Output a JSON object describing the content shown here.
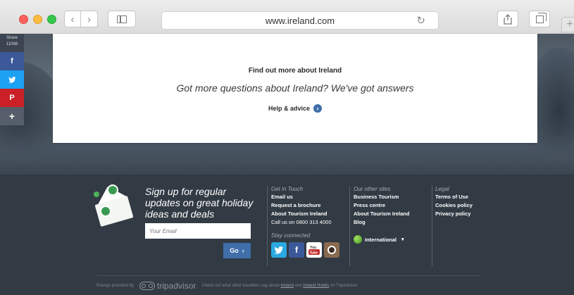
{
  "browser": {
    "url": "www.ireland.com",
    "icons": {
      "back": "chevron-left-icon",
      "forward": "chevron-right-icon",
      "sidebar": "sidebar-icon",
      "reload": "reload-icon",
      "share": "share-icon",
      "tabs": "tabs-icon",
      "new_tab": "plus-icon"
    }
  },
  "share_bar": {
    "label": "Share",
    "count": "11068",
    "items": [
      {
        "icon": "facebook-icon",
        "glyph": "f"
      },
      {
        "icon": "twitter-icon",
        "glyph": "t"
      },
      {
        "icon": "pinterest-icon",
        "glyph": "p"
      },
      {
        "icon": "plus-icon",
        "glyph": "+"
      }
    ]
  },
  "card": {
    "title": "Find out more about Ireland",
    "subtitle": "Got more questions about Ireland? We've got answers",
    "link": "Help & advice"
  },
  "footer": {
    "signup": {
      "heading": "Sign up for regular updates on great holiday ideas and deals",
      "email_placeholder": "Your Email",
      "go_label": "Go",
      "go_arrow": "›"
    },
    "contact": {
      "heading": "Get in Touch",
      "email": "Email us",
      "brochure": "Request a brochure",
      "about": "About Tourism Ireland",
      "phone": "Call us on 0800 313 4000",
      "stay_heading": "Stay connected",
      "socials": [
        "twitter-icon",
        "facebook-icon",
        "youtube-icon",
        "instagram-icon"
      ]
    },
    "other_sites": {
      "heading": "Our other sites",
      "links": [
        "Business Tourism",
        "Press centre",
        "About Tourism Ireland",
        "Blog"
      ],
      "region": "International"
    },
    "legal": {
      "heading": "Legal",
      "links": [
        "Terms of Use",
        "Cookies policy",
        "Privacy policy"
      ]
    },
    "ratings": {
      "provided_by": "Ratings provided by",
      "brand": "tripadvisor",
      "prefix": "Check out what other travellers say about",
      "link1": "Ireland",
      "and": "and",
      "link2": "Ireland Hotels",
      "suffix": "on TripAdvisor."
    }
  },
  "colors": {
    "footer_bg": "#323a44",
    "accent_blue": "#3f6ea8",
    "facebook": "#3b5998",
    "twitter": "#1da1f2",
    "pinterest": "#cb2027"
  }
}
